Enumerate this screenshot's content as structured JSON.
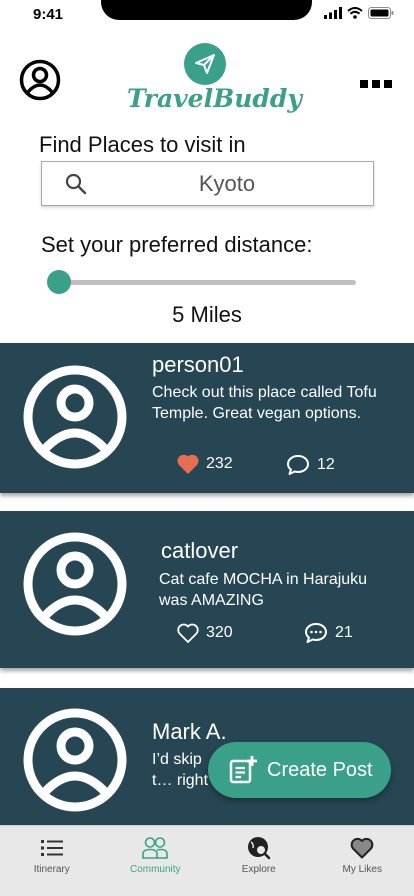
{
  "status_bar": {
    "time": "9:41"
  },
  "header": {
    "app_name": "TravelBuddy"
  },
  "search": {
    "label": "Find Places to visit in",
    "value": "Kyoto"
  },
  "distance": {
    "label": "Set your preferred distance:",
    "value_text": "5 Miles",
    "slider_fraction": 0.0
  },
  "posts": [
    {
      "user": "person01",
      "text": "Check out this place called Tofu Temple. Great vegan options.",
      "likes": "232",
      "comments": "12",
      "liked": true
    },
    {
      "user": "catlover",
      "text": "Cat cafe MOCHA in Harajuku was AMAZING",
      "likes": "320",
      "comments": "21",
      "liked": false
    },
    {
      "user": "Mark A.",
      "text": "I’d skip t… right no…",
      "likes": "",
      "comments": "",
      "liked": false
    }
  ],
  "create_post": {
    "label": "Create Post"
  },
  "tabs": [
    {
      "label": "Itinerary",
      "icon": "list-icon"
    },
    {
      "label": "Community",
      "icon": "people-icon",
      "active": true
    },
    {
      "label": "Explore",
      "icon": "globe-search-icon"
    },
    {
      "label": "My Likes",
      "icon": "heart-icon"
    }
  ],
  "colors": {
    "accent": "#3aa08a",
    "card_bg": "#264653",
    "like_active": "#e76f51"
  }
}
